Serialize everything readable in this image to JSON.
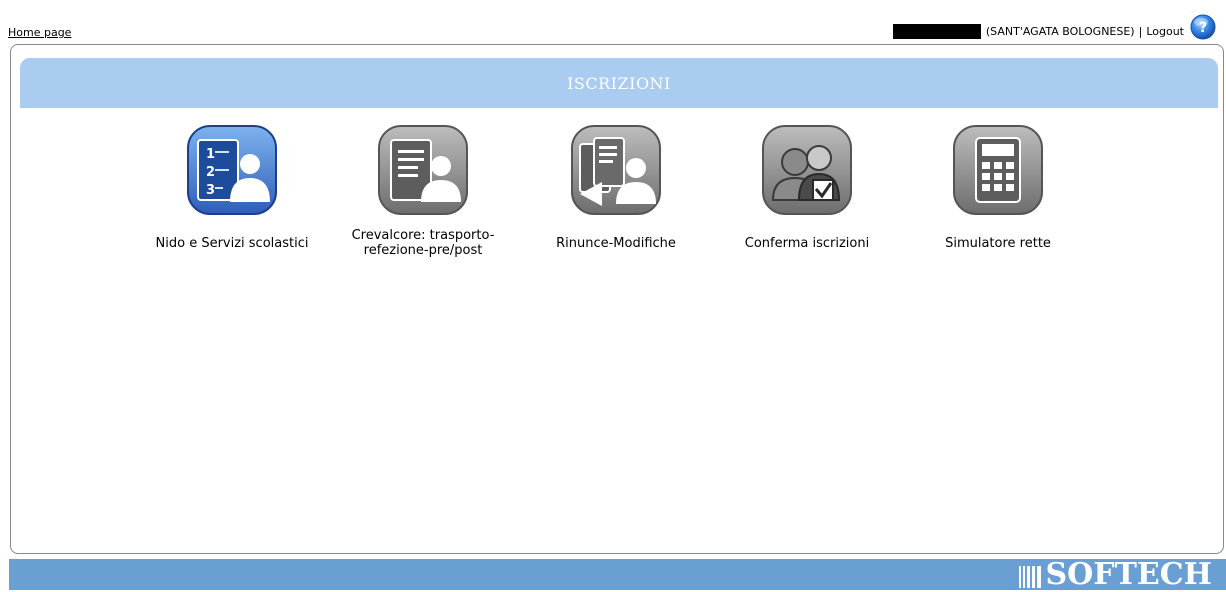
{
  "top": {
    "home_link": "Home page",
    "user_location": "(SANT'AGATA BOLOGNESE)",
    "separator": "|",
    "logout": "Logout",
    "help_icon": "help-question-icon"
  },
  "panel": {
    "title": "ISCRIZIONI"
  },
  "tiles": [
    {
      "label": "Nido e Servizi scolastici",
      "icon": "numbered-form-person-icon"
    },
    {
      "label": "Crevalcore: trasporto-refezione-pre/post",
      "line1": "Crevalcore: trasporto-",
      "line2": "refezione-pre/post",
      "icon": "document-person-icon"
    },
    {
      "label": "Rinunce-Modifiche",
      "icon": "return-documents-person-icon"
    },
    {
      "label": "Conferma iscrizioni",
      "icon": "people-checkmark-icon"
    },
    {
      "label": "Simulatore rette",
      "icon": "calculator-icon"
    }
  ],
  "footer": {
    "brand": "SOFTECH",
    "brand_icon": "softech-bars-logo"
  },
  "colors": {
    "header_bg": "#a9ccf0",
    "footer_bg": "#6a9fd4",
    "active_tile": "#3f7fd6",
    "inactive_tile": "#8a8a8a"
  }
}
